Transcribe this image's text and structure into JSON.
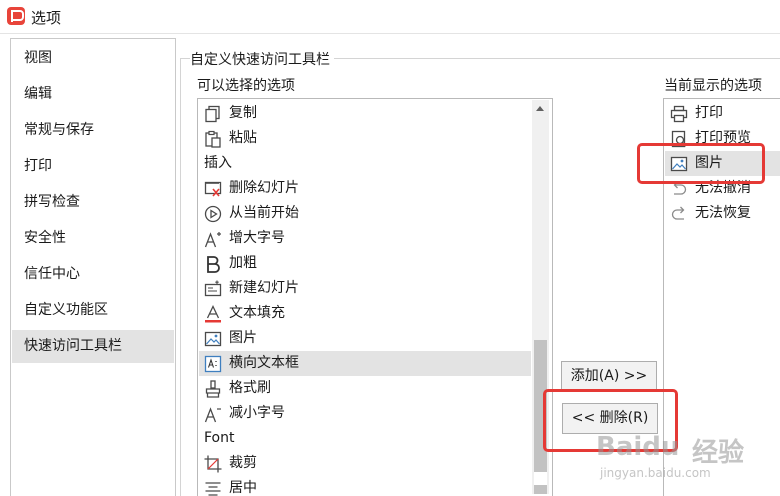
{
  "window": {
    "title": "选项"
  },
  "nav": {
    "items": [
      {
        "label": "视图"
      },
      {
        "label": "编辑"
      },
      {
        "label": "常规与保存"
      },
      {
        "label": "打印"
      },
      {
        "label": "拼写检查"
      },
      {
        "label": "安全性"
      },
      {
        "label": "信任中心"
      },
      {
        "label": "自定义功能区"
      },
      {
        "label": "快速访问工具栏",
        "selected": true
      }
    ]
  },
  "section": {
    "title": "自定义快速访问工具栏"
  },
  "available": {
    "label": "可以选择的选项",
    "items": [
      {
        "label": "复制",
        "icon": "copy-icon"
      },
      {
        "label": "粘贴",
        "icon": "paste-icon"
      },
      {
        "label": "插入",
        "icon": ""
      },
      {
        "label": "删除幻灯片",
        "icon": "delete-slide-icon"
      },
      {
        "label": "从当前开始",
        "icon": "play-from-current-icon"
      },
      {
        "label": "增大字号",
        "icon": "increase-font-icon"
      },
      {
        "label": "加粗",
        "icon": "bold-icon"
      },
      {
        "label": "新建幻灯片",
        "icon": "new-slide-icon"
      },
      {
        "label": "文本填充",
        "icon": "text-fill-icon"
      },
      {
        "label": "图片",
        "icon": "picture-icon"
      },
      {
        "label": "横向文本框",
        "icon": "textbox-icon",
        "selected": true
      },
      {
        "label": "格式刷",
        "icon": "format-painter-icon"
      },
      {
        "label": "减小字号",
        "icon": "decrease-font-icon"
      },
      {
        "label": "Font",
        "icon": ""
      },
      {
        "label": "裁剪",
        "icon": "crop-icon"
      },
      {
        "label": "居中",
        "icon": "center-align-icon"
      }
    ]
  },
  "current": {
    "label": "当前显示的选项",
    "items": [
      {
        "label": "打印",
        "icon": "printer-icon"
      },
      {
        "label": "打印预览",
        "icon": "print-preview-icon"
      },
      {
        "label": "图片",
        "icon": "picture-icon",
        "selected": true
      },
      {
        "label": "无法撤消",
        "icon": "undo-icon"
      },
      {
        "label": "无法恢复",
        "icon": "redo-icon"
      }
    ]
  },
  "buttons": {
    "add": "添加(A) >>",
    "remove": "<< 删除(R)"
  },
  "watermark": {
    "logo": "Baidu",
    "jingyan": "经验",
    "url": "jingyan.baidu.com"
  },
  "colors": {
    "highlight_red": "#e53935",
    "selected_bg": "#e3e3e3",
    "app_logo": "#e8443a"
  }
}
